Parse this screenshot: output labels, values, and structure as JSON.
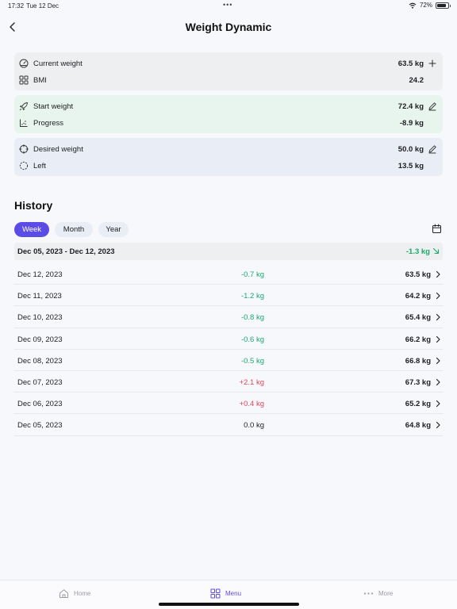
{
  "status_bar": {
    "time": "17:32",
    "date": "Tue 12 Dec",
    "dots": "•••",
    "battery": "72%",
    "battery_level": 0.72
  },
  "header": {
    "title": "Weight Dynamic",
    "back_icon": "chevron-left-icon"
  },
  "summary": {
    "current": {
      "label": "Current weight",
      "value": "63.5 kg",
      "icon": "gauge-icon",
      "action_icon": "plus-icon"
    },
    "bmi": {
      "label": "BMI",
      "value": "24.2",
      "icon": "grid-icon"
    },
    "start": {
      "label": "Start weight",
      "value": "72.4 kg",
      "icon": "rocket-icon",
      "action_icon": "pencil-icon"
    },
    "progress": {
      "label": "Progress",
      "value": "-8.9 kg",
      "icon": "chart-icon"
    },
    "desired": {
      "label": "Desired weight",
      "value": "50.0 kg",
      "icon": "target-icon",
      "action_icon": "pencil-icon"
    },
    "left": {
      "label": "Left",
      "value": "13.5 kg",
      "icon": "progress-ring-icon"
    }
  },
  "history": {
    "title": "History",
    "tabs": [
      {
        "label": "Week",
        "active": true
      },
      {
        "label": "Month",
        "active": false
      },
      {
        "label": "Year",
        "active": false
      }
    ],
    "range": {
      "label": "Dec 05, 2023  -  Dec 12, 2023",
      "change": "-1.3 kg"
    },
    "rows": [
      {
        "date": "Dec 12, 2023",
        "change": "-0.7 kg",
        "trend": "neg",
        "weight": "63.5 kg"
      },
      {
        "date": "Dec 11, 2023",
        "change": "-1.2 kg",
        "trend": "neg",
        "weight": "64.2 kg"
      },
      {
        "date": "Dec 10, 2023",
        "change": "-0.8 kg",
        "trend": "neg",
        "weight": "65.4 kg"
      },
      {
        "date": "Dec 09, 2023",
        "change": "-0.6 kg",
        "trend": "neg",
        "weight": "66.2 kg"
      },
      {
        "date": "Dec 08, 2023",
        "change": "-0.5 kg",
        "trend": "neg",
        "weight": "66.8 kg"
      },
      {
        "date": "Dec 07, 2023",
        "change": "+2.1 kg",
        "trend": "pos",
        "weight": "67.3 kg"
      },
      {
        "date": "Dec 06, 2023",
        "change": "+0.4 kg",
        "trend": "pos",
        "weight": "65.2 kg"
      },
      {
        "date": "Dec 05, 2023",
        "change": "0.0 kg",
        "trend": "zero",
        "weight": "64.8 kg"
      }
    ]
  },
  "bottom_nav": {
    "home": {
      "label": "Home",
      "icon": "home-icon"
    },
    "menu": {
      "label": "Menu",
      "icon": "grid-icon"
    },
    "more": {
      "label": "More",
      "icon": "more-dots-icon"
    }
  },
  "colors": {
    "accent": "#5b4ce6",
    "negative_change": "#1ba86e",
    "positive_change": "#e0475a"
  }
}
